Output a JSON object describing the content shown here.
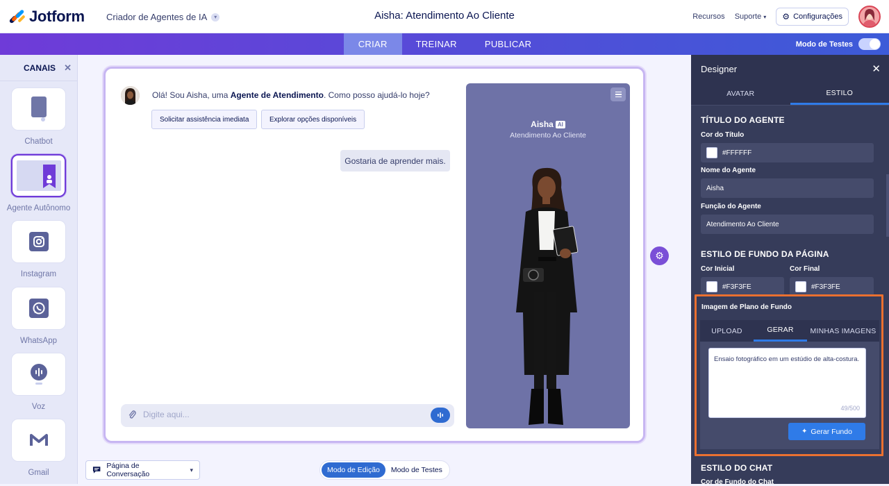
{
  "header": {
    "logo_text": "Jotform",
    "builder_select": "Criador de Agentes de IA",
    "title": "Aisha: Atendimento Ao Cliente",
    "links": [
      "Recursos",
      "Suporte"
    ],
    "settings_label": "Configurações"
  },
  "nav": {
    "tabs": [
      "CRIAR",
      "TREINAR",
      "PUBLICAR"
    ],
    "active_tab": "CRIAR",
    "test_mode_label": "Modo de Testes"
  },
  "sidebar": {
    "title": "CANAIS",
    "channels": [
      {
        "label": "Chatbot",
        "icon": "chatbot-icon"
      },
      {
        "label": "Agente Autônomo",
        "icon": "autonomous-agent-icon",
        "selected": true
      },
      {
        "label": "Instagram",
        "icon": "instagram-icon"
      },
      {
        "label": "WhatsApp",
        "icon": "whatsapp-icon"
      },
      {
        "label": "Voz",
        "icon": "voice-icon"
      },
      {
        "label": "Gmail",
        "icon": "gmail-icon"
      }
    ]
  },
  "chat": {
    "greeting_pre": "Olá! Sou Aisha, uma ",
    "greeting_bold": "Agente de Atendimento",
    "greeting_post": ". Como posso ajudá-lo hoje?",
    "quick_replies": [
      "Solicitar assistência imediata",
      "Explorar opções disponíveis"
    ],
    "user_message": "Gostaria de aprender mais.",
    "input_placeholder": "Digite aqui..."
  },
  "preview": {
    "agent_name": "Aisha",
    "badge": "AI",
    "agent_role": "Atendimento Ao Cliente",
    "background": "#6e72a7"
  },
  "bottom": {
    "page_select": "Página de Conversação",
    "modes": [
      "Modo de Edição",
      "Modo de Testes"
    ],
    "active_mode": "Modo de Edição"
  },
  "designer": {
    "title": "Designer",
    "tabs": [
      "AVATAR",
      "ESTILO"
    ],
    "active_tab": "ESTILO",
    "agent_title_section": "TÍTULO DO AGENTE",
    "title_color_label": "Cor do Título",
    "title_color": "#FFFFFF",
    "agent_name_label": "Nome do Agente",
    "agent_name": "Aisha",
    "agent_role_label": "Função do Agente",
    "agent_role": "Atendimento Ao Cliente",
    "page_bg_section": "ESTILO DE FUNDO DA PÁGINA",
    "start_color_label": "Cor Inicial",
    "start_color": "#F3F3FE",
    "end_color_label": "Cor Final",
    "end_color": "#F3F3FE",
    "bg_image": {
      "title": "Imagem de Plano de Fundo",
      "tabs": [
        "UPLOAD",
        "GERAR",
        "MINHAS IMAGENS"
      ],
      "active_tab": "GERAR",
      "prompt": "Ensaio fotográfico em um estúdio de alta-costura.",
      "char_count": "49/500",
      "generate_label": "Gerar Fundo"
    },
    "chat_style_section": "ESTILO DO CHAT",
    "chat_bg_label": "Cor de Fundo do Chat"
  },
  "colors": {
    "accent": "#2f6bd1",
    "brand_purple": "#6f3bd8",
    "highlight": "#ea7030"
  }
}
